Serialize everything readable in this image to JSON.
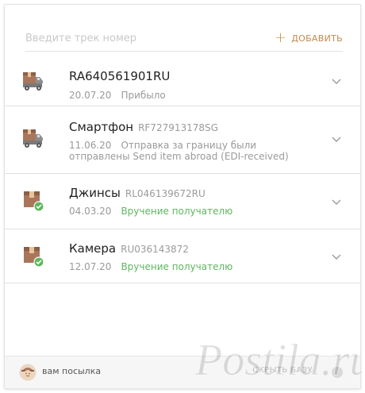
{
  "search": {
    "placeholder": "Введите трек номер",
    "add_label": "ДОБАВИТЬ"
  },
  "parcels": [
    {
      "name": "",
      "track": "RA640561901RU",
      "date": "20.07.20",
      "status": "Прибыло",
      "status_color": "#9a9a9a",
      "icon": "truck-box-icon"
    },
    {
      "name": "Смартфон",
      "track": "RF727913178SG",
      "date": "11.06.20",
      "status_line1": "Отправка за границу были",
      "status_line2": "отправлены Send item abroad (EDI-received)",
      "status_color": "#9a9a9a",
      "icon": "truck-box-icon"
    },
    {
      "name": "Джинсы",
      "track": "RL046139672RU",
      "date": "04.03.20",
      "status": "Вручение получателю",
      "status_color": "#5fb65f",
      "icon": "box-check-icon"
    },
    {
      "name": "Камера",
      "track": "RU036143872",
      "date": "12.07.20",
      "status": "Вручение получателю",
      "status_color": "#5fb65f",
      "icon": "box-check-icon"
    }
  ],
  "footer": {
    "brand": "вам посылка",
    "hide_label": "СКРЫТЬ БАЗУ"
  },
  "watermark": {
    "text": "Postila.ru"
  },
  "colors": {
    "accent": "#c58b45",
    "delivered": "#5fb65f",
    "box": "#a9765b",
    "box_dark": "#8a5f4a",
    "truck": "#7a7a7a"
  }
}
